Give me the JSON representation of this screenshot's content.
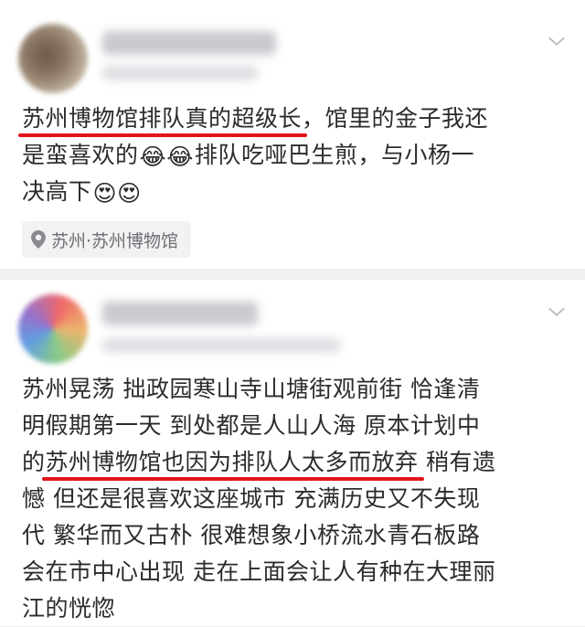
{
  "post1": {
    "author_icon": "avatar",
    "lines": [
      {
        "parts": [
          {
            "text": "苏州博物馆排队真的超级长",
            "underline": true
          },
          {
            "text": "，馆里的金子我还",
            "underline": false
          }
        ]
      },
      {
        "parts": [
          {
            "text": "是蛮喜欢的",
            "underline": false
          },
          {
            "emoji": "😂😂"
          },
          {
            "text": "排队吃哑巴生煎，与小杨一",
            "underline": false
          }
        ]
      },
      {
        "parts": [
          {
            "text": "决高下",
            "underline": false
          },
          {
            "emoji": "😍😍"
          }
        ]
      }
    ],
    "location": "苏州·苏州博物馆",
    "location_icon": "location-pin-icon",
    "menu_icon": "chevron-down-icon"
  },
  "post2": {
    "author_icon": "avatar",
    "lines": [
      {
        "parts": [
          {
            "text": "苏州晃荡 拙政园寒山寺山塘街观前街 恰逢清",
            "underline": false
          }
        ]
      },
      {
        "parts": [
          {
            "text": "明假期第一天 到处都是人山人海 原本计划中",
            "underline": false
          }
        ]
      },
      {
        "parts": [
          {
            "text": "的",
            "underline": false
          },
          {
            "text": "苏州博物馆也因为排队人太多而放弃",
            "underline": true
          },
          {
            "text": " 稍有遗",
            "underline": false
          }
        ]
      },
      {
        "parts": [
          {
            "text": "憾 但还是很喜欢这座城市 充满历史又不失现",
            "underline": false
          }
        ]
      },
      {
        "parts": [
          {
            "text": "代 繁华而又古朴 很难想象小桥流水青石板路",
            "underline": false
          }
        ]
      },
      {
        "parts": [
          {
            "text": "会在市中心出现 走在上面会让人有种在大理丽",
            "underline": false
          }
        ]
      },
      {
        "parts": [
          {
            "text": "江的恍惚",
            "underline": false
          }
        ]
      }
    ],
    "menu_icon": "chevron-down-icon"
  },
  "colors": {
    "underline": "#e1141d",
    "background": "#efeff2",
    "text": "#2b2b2b"
  }
}
